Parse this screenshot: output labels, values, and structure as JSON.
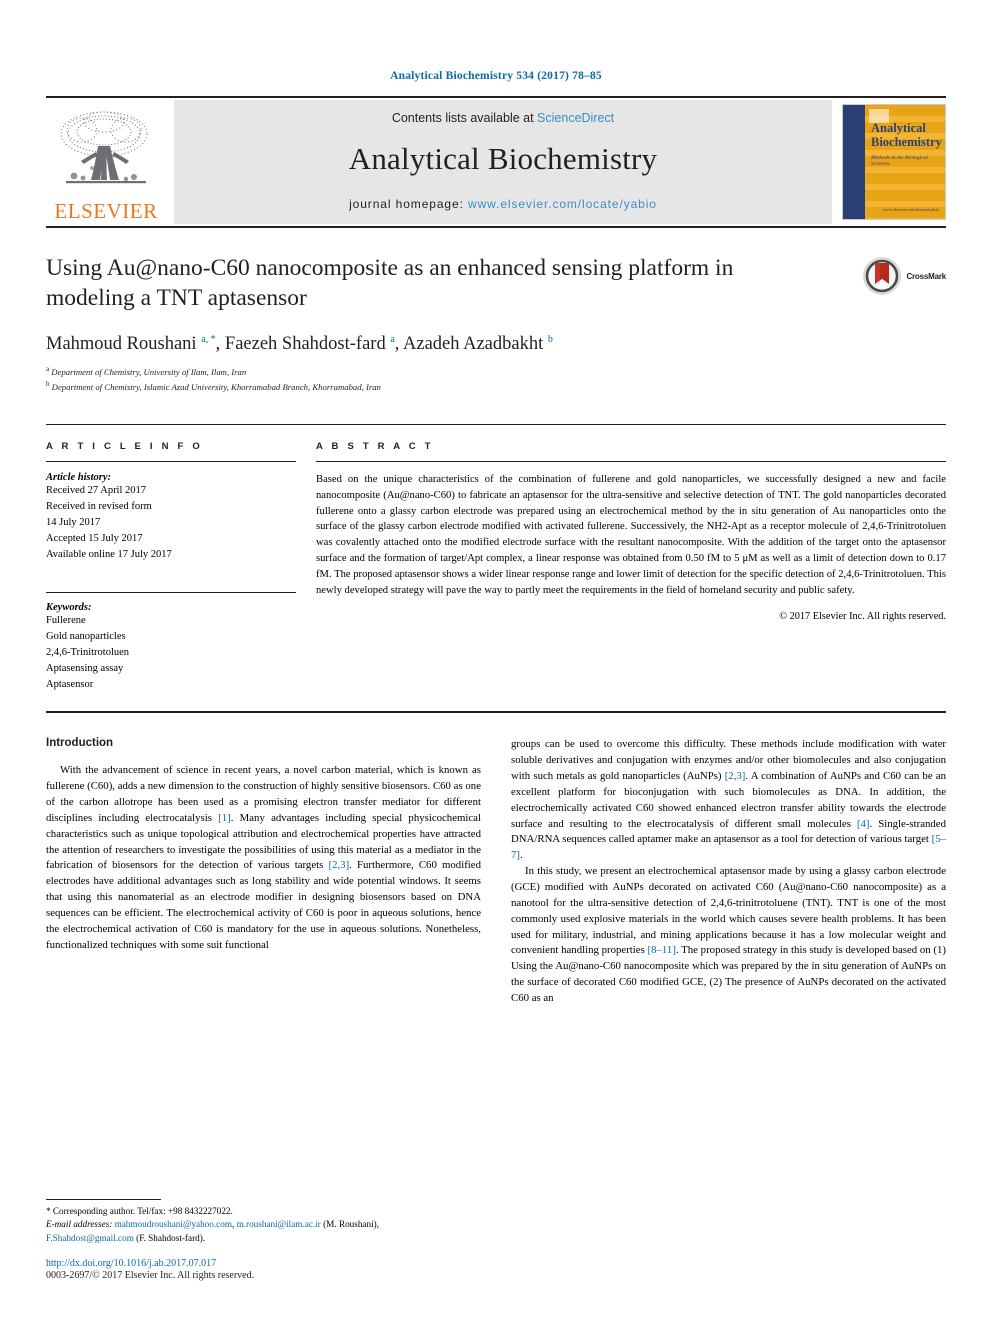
{
  "running_head": "Analytical Biochemistry 534 (2017) 78–85",
  "masthead": {
    "publisher_logo_text": "ELSEVIER",
    "contents_prefix": "Contents lists available at ",
    "contents_link": "ScienceDirect",
    "journal_name": "Analytical Biochemistry",
    "homepage_prefix": "journal homepage: ",
    "homepage_url": "www.elsevier.com/locate/yabio",
    "cover": {
      "title_line1": "Analytical",
      "title_line2": "Biochemistry",
      "subtitle": "Methods in the Biological Sciences",
      "footer": "www.elsevier.com/locate/yabio"
    }
  },
  "article": {
    "title": "Using Au@nano-C60 nanocomposite as an enhanced sensing platform in modeling a TNT aptasensor",
    "authors_html": "Mahmoud Roushani <sup>a, *</sup>, Faezeh Shahdost-fard <sup>a</sup>, Azadeh Azadbakht <sup>b</sup>",
    "affiliations": [
      {
        "marker": "a",
        "text": "Department of Chemistry, University of Ilam, Ilam, Iran"
      },
      {
        "marker": "b",
        "text": "Department of Chemistry, Islamic Azad University, Khorramabad Branch, Khorramabad, Iran"
      }
    ],
    "crossmark_label": "CrossMark"
  },
  "article_info": {
    "heading": "A R T I C L E    I N F O",
    "history_label": "Article history:",
    "history": [
      "Received 27 April 2017",
      "Received in revised form",
      "14 July 2017",
      "Accepted 15 July 2017",
      "Available online 17 July 2017"
    ],
    "keywords_label": "Keywords:",
    "keywords": [
      "Fullerene",
      "Gold nanoparticles",
      "2,4,6-Trinitrotoluen",
      "Aptasensing assay",
      "Aptasensor"
    ]
  },
  "abstract": {
    "heading": "A B S T R A C T",
    "text": "Based on the unique characteristics of the combination of fullerene and gold nanoparticles, we successfully designed a new and facile nanocomposite (Au@nano-C60) to fabricate an aptasensor for the ultra-sensitive and selective detection of TNT. The gold nanoparticles decorated fullerene onto a glassy carbon electrode was prepared using an electrochemical method by the in situ generation of Au nanoparticles onto the surface of the glassy carbon electrode modified with activated fullerene. Successively, the NH2-Apt as a receptor molecule of 2,4,6-Trinitrotoluen was covalently attached onto the modified electrode surface with the resultant nanocomposite. With the addition of the target onto the aptasensor surface and the formation of target/Apt complex, a linear response was obtained from 0.50 fM to 5 μM as well as a limit of detection down to 0.17 fM. The proposed aptasensor shows a wider linear response range and lower limit of detection for the specific detection of 2,4,6-Trinitrotoluen. This newly developed strategy will pave the way to partly meet the requirements in the field of homeland security and public safety.",
    "copyright": "© 2017 Elsevier Inc. All rights reserved."
  },
  "body": {
    "intro_heading": "Introduction",
    "left_para_1": "With the advancement of science in recent years, a novel carbon material, which is known as fullerene (C60), adds a new dimension to the construction of highly sensitive biosensors. C60 as one of the carbon allotrope has been used as a promising electron transfer mediator for different disciplines including electrocatalysis [1]. Many advantages including special physicochemical characteristics such as unique topological attribution and electrochemical properties have attracted the attention of researchers to investigate the possibilities of using this material as a mediator in the fabrication of biosensors for the detection of various targets [2,3]. Furthermore, C60 modified electrodes have additional advantages such as long stability and wide potential windows. It seems that using this nanomaterial as an electrode modifier in designing biosensors based on DNA sequences can be efficient. The electrochemical activity of C60 is poor in aqueous solutions, hence the electrochemical activation of C60 is mandatory for the use in aqueous solutions. Nonetheless, functionalized techniques with some suit functional",
    "right_para_1": "groups can be used to overcome this difficulty. These methods include modification with water soluble derivatives and conjugation with enzymes and/or other biomolecules and also conjugation with such metals as gold nanoparticles (AuNPs) [2,3]. A combination of AuNPs and C60 can be an excellent platform for bioconjugation with such biomolecules as DNA. In addition, the electrochemically activated C60 showed enhanced electron transfer ability towards the electrode surface and resulting to the electrocatalysis of different small molecules [4]. Single-stranded DNA/RNA sequences called aptamer make an aptasensor as a tool for detection of various target [5–7].",
    "right_para_2": "In this study, we present an electrochemical aptasensor made by using a glassy carbon electrode (GCE) modified with AuNPs decorated on activated C60 (Au@nano-C60 nanocomposite) as a nanotool for the ultra-sensitive detection of 2,4,6-trinitrotoluene (TNT). TNT is one of the most commonly used explosive materials in the world which causes severe health problems. It has been used for military, industrial, and mining applications because it has a low molecular weight and convenient handling properties [8–11]. The proposed strategy in this study is developed based on (1) Using the Au@nano-C60 nanocomposite which was prepared by the in situ generation of AuNPs on the surface of decorated C60 modified GCE, (2) The presence of AuNPs decorated on the activated C60 as an"
  },
  "footnote": {
    "corresponding": "* Corresponding author. Tel/fax: +98 8432227022.",
    "email_label": "E-mail addresses:",
    "email_1": "mahmoudroushani@yahoo.com",
    "email_2": "m.roushani@ilam.ac.ir",
    "email_1_owner": "(M. Roushani),",
    "email_3": "F.Shahdost@gmail.com",
    "email_3_owner": "(F. Shahdost-fard).",
    "doi": "http://dx.doi.org/10.1016/j.ab.2017.07.017",
    "issn": "0003-2697/© 2017 Elsevier Inc. All rights reserved."
  },
  "colors": {
    "link": "#0b6aa2",
    "accent_orange": "#e87722",
    "cover_navy": "#2b3f74",
    "cover_gold": "#f2b632"
  }
}
